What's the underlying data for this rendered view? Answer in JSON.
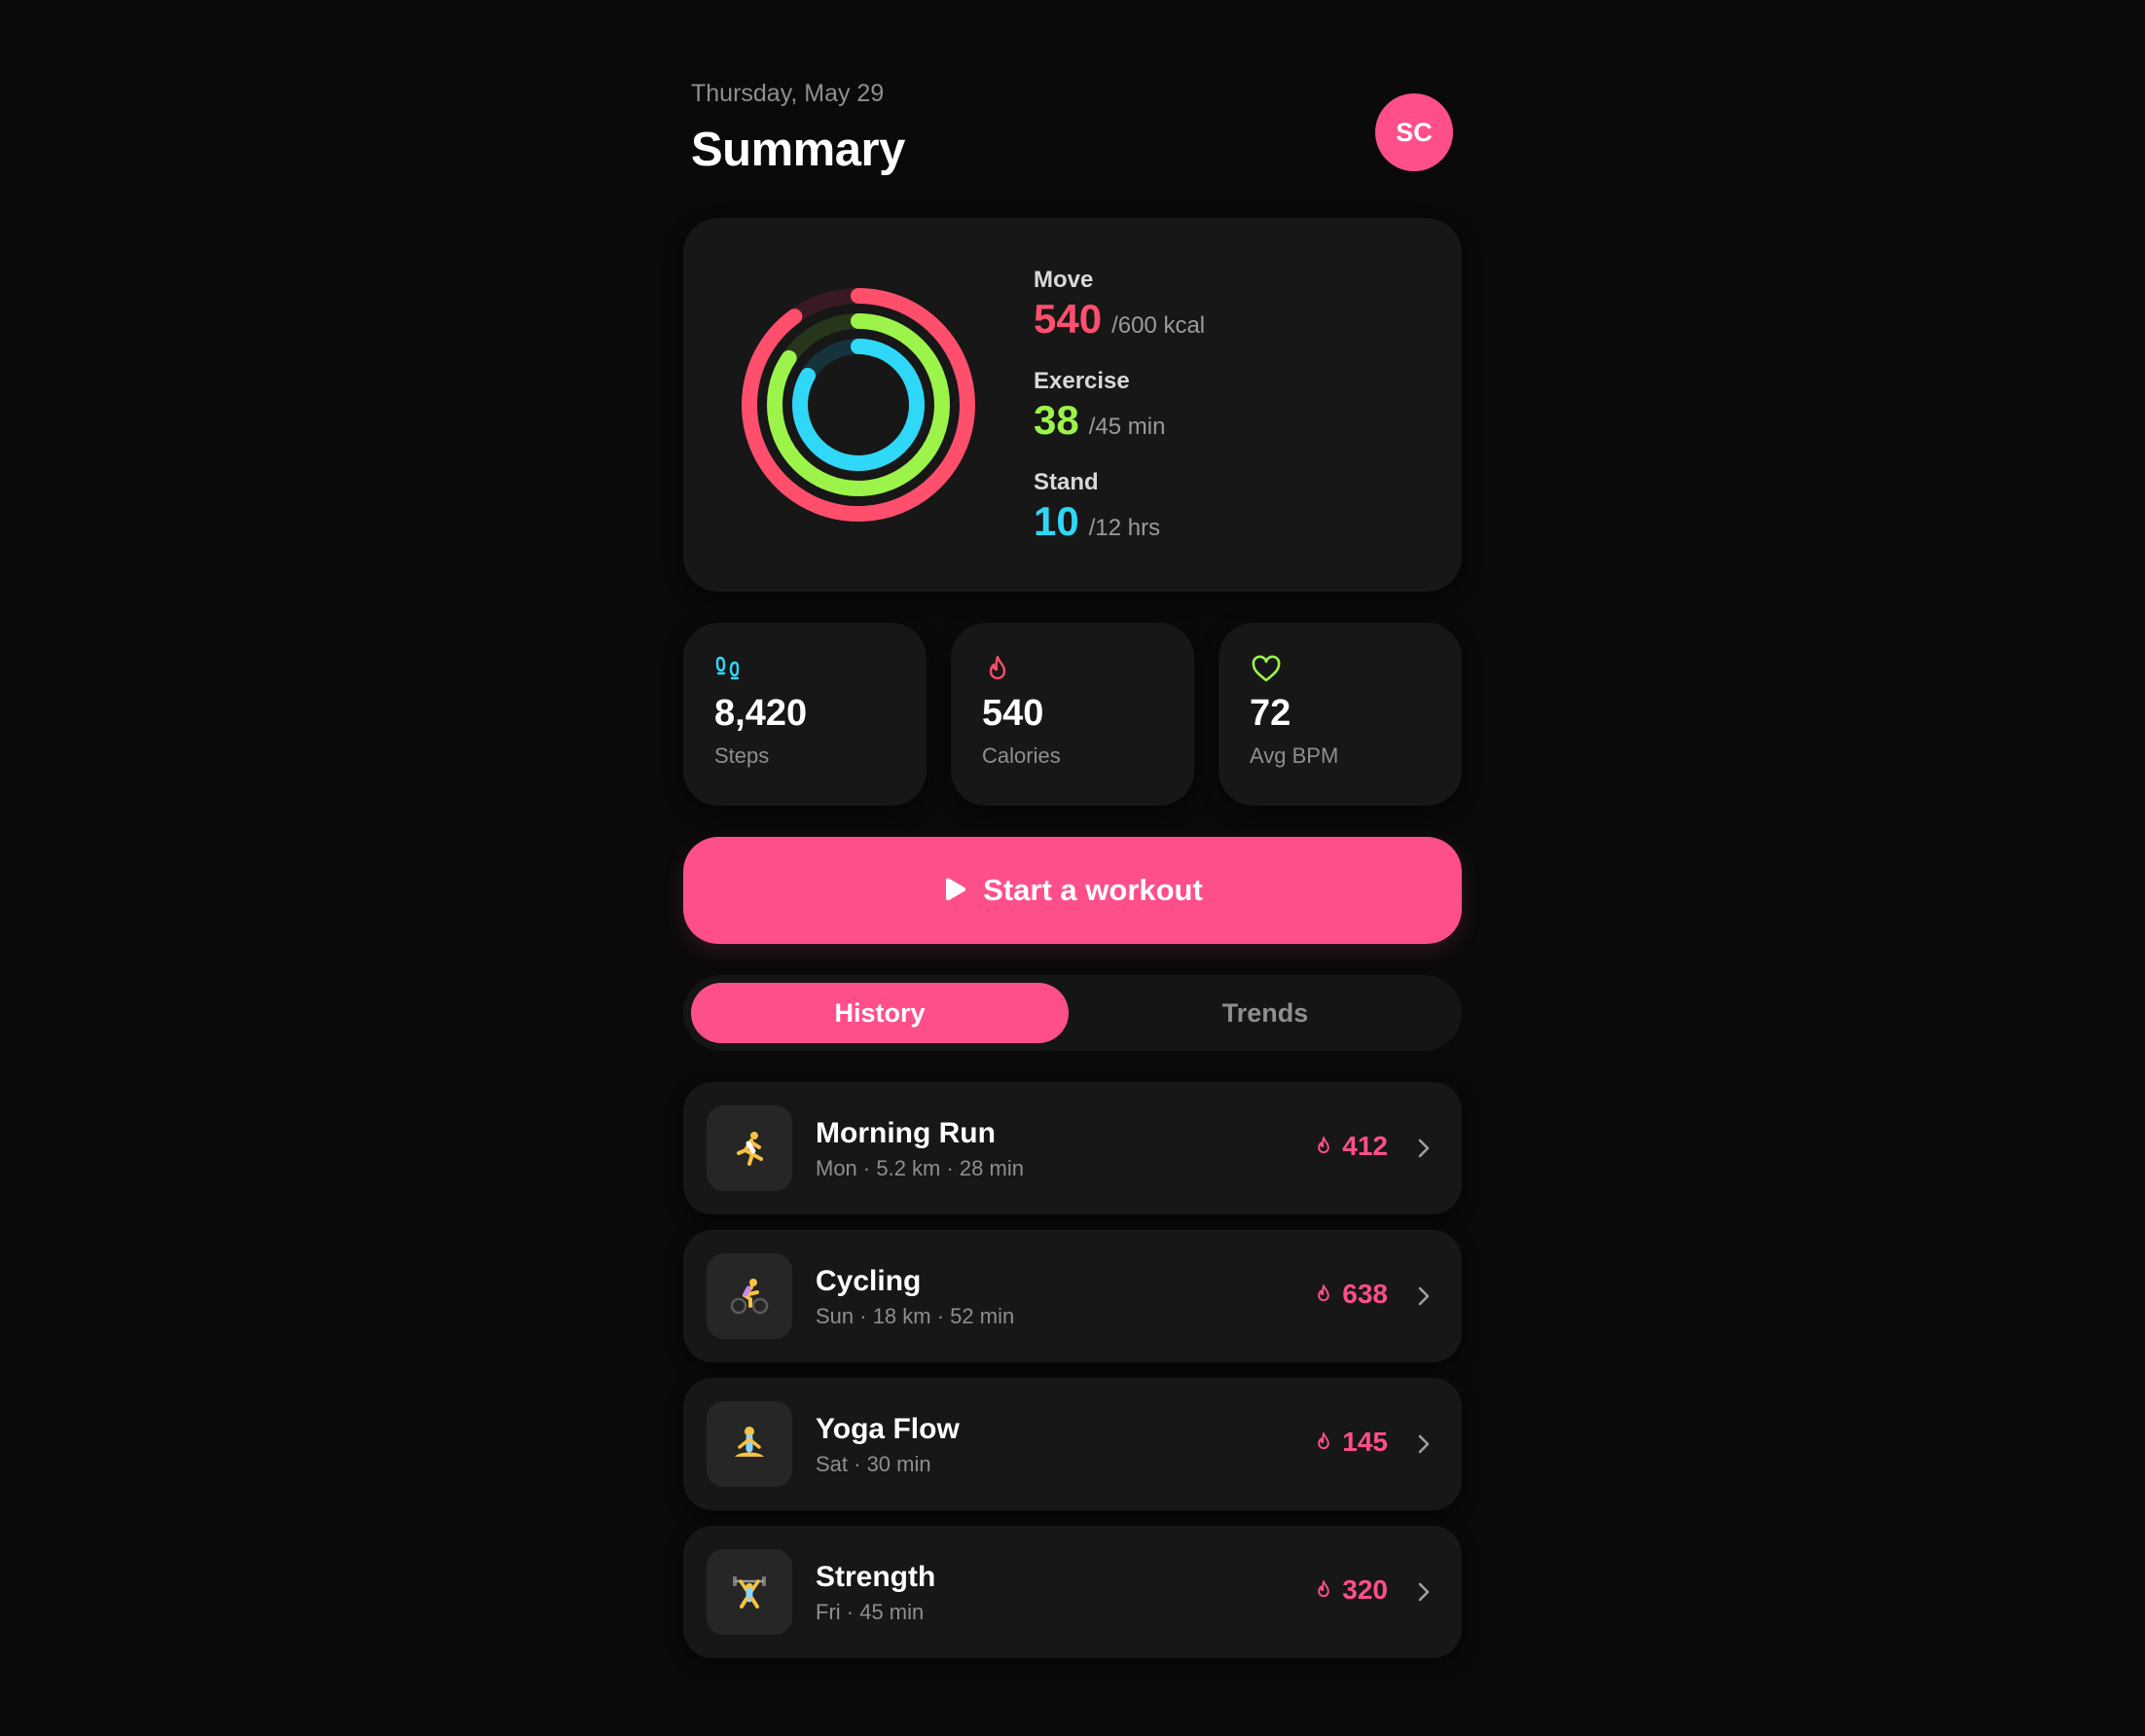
{
  "header": {
    "date": "Thursday, May 29",
    "title": "Summary",
    "avatar_initials": "SC"
  },
  "rings": {
    "move": {
      "label": "Move",
      "value": "540",
      "goal": "/600 kcal",
      "progress": 0.9,
      "color": "#ff4f6d"
    },
    "exercise": {
      "label": "Exercise",
      "value": "38",
      "goal": "/45 min",
      "progress": 0.844,
      "color": "#9cf44a"
    },
    "stand": {
      "label": "Stand",
      "value": "10",
      "goal": "/12 hrs",
      "progress": 0.833,
      "color": "#2fd8f6"
    }
  },
  "stats": [
    {
      "icon": "footprints-icon",
      "value": "8,420",
      "label": "Steps",
      "color": "#2fd8f6"
    },
    {
      "icon": "flame-icon",
      "value": "540",
      "label": "Calories",
      "color": "#ff4f6d"
    },
    {
      "icon": "heart-icon",
      "value": "72",
      "label": "Avg BPM",
      "color": "#9cf44a"
    }
  ],
  "start_button": {
    "label": "Start a workout",
    "icon": "play-icon"
  },
  "tabs": [
    {
      "label": "History",
      "active": true
    },
    {
      "label": "Trends",
      "active": false
    }
  ],
  "workouts": [
    {
      "icon": "runner-icon",
      "name": "Morning Run",
      "meta": "Mon · 5.2 km · 28 min",
      "calories": "412"
    },
    {
      "icon": "cyclist-icon",
      "name": "Cycling",
      "meta": "Sun · 18 km · 52 min",
      "calories": "638"
    },
    {
      "icon": "yoga-icon",
      "name": "Yoga Flow",
      "meta": "Sat · 30 min",
      "calories": "145"
    },
    {
      "icon": "weightlifter-icon",
      "name": "Strength",
      "meta": "Fri · 45 min",
      "calories": "320"
    }
  ],
  "colors": {
    "accent": "#ff4f8b",
    "background": "#0a0a0a",
    "card": "#171717"
  }
}
